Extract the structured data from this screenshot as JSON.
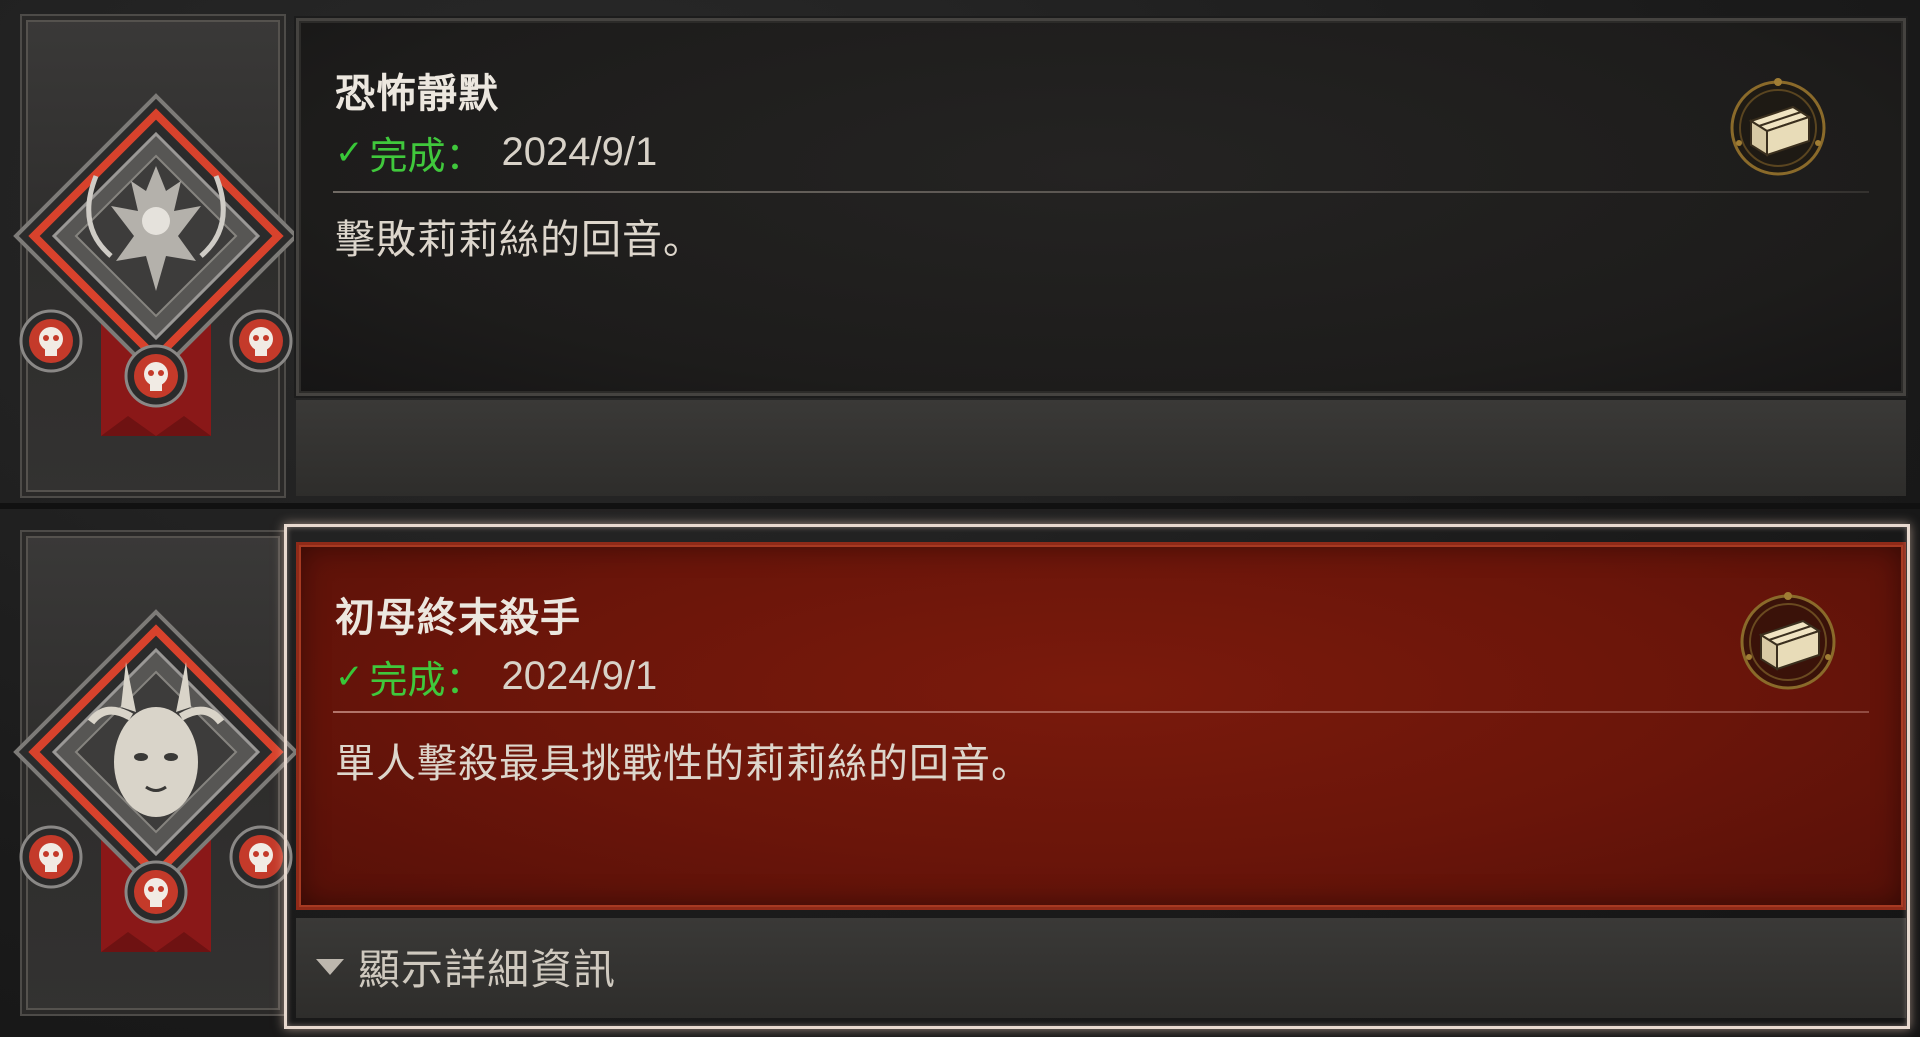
{
  "achievements": [
    {
      "title": "恐怖靜默",
      "status_check": "✓",
      "status_label": "完成：",
      "status_date": "2024/9/1",
      "description": "擊敗莉莉絲的回音。",
      "state": "completed",
      "reward_icon": "treasure-chest-icon"
    },
    {
      "title": "初母終末殺手",
      "status_check": "✓",
      "status_label": "完成：",
      "status_date": "2024/9/1",
      "description": "單人擊殺最具挑戰性的莉莉絲的回音。",
      "state": "completed-selected",
      "reward_icon": "treasure-chest-icon"
    }
  ],
  "details_toggle": {
    "label": "顯示詳細資訊",
    "icon": "caret-down-icon"
  },
  "colors": {
    "selected_panel": "#6a150a",
    "complete_green": "#40c83c",
    "badge_red": "#d8422c"
  }
}
